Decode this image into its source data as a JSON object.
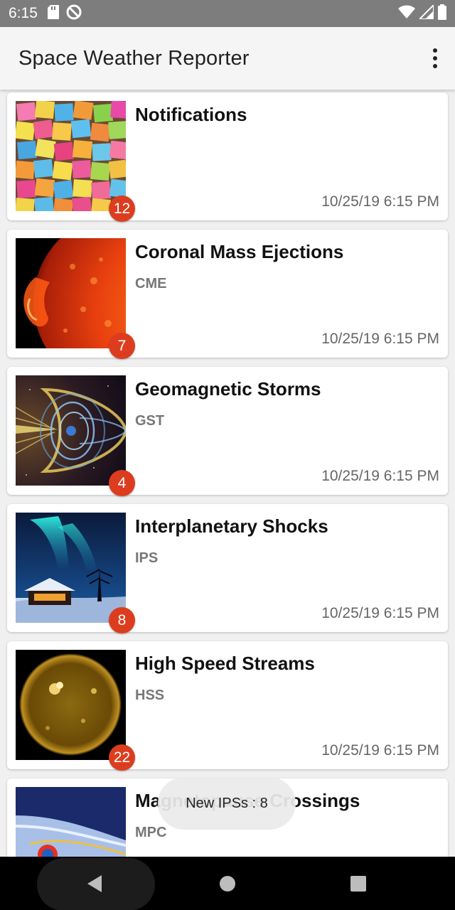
{
  "status_bar": {
    "time": "6:15",
    "icons": [
      "sd-card-icon",
      "no-disturb-icon",
      "wifi-icon",
      "signal-icon",
      "battery-icon"
    ]
  },
  "app_bar": {
    "title": "Space Weather Reporter",
    "overflow_icon": "more-vert-icon"
  },
  "cards": [
    {
      "title": "Notifications",
      "subtitle": "",
      "badge": "12",
      "timestamp": "10/25/19 6:15 PM",
      "image": "sticky-notes-image"
    },
    {
      "title": "Coronal Mass Ejections",
      "subtitle": "CME",
      "badge": "7",
      "timestamp": "10/25/19 6:15 PM",
      "image": "sun-flare-image"
    },
    {
      "title": "Geomagnetic Storms",
      "subtitle": "GST",
      "badge": "4",
      "timestamp": "10/25/19 6:15 PM",
      "image": "magnetosphere-image"
    },
    {
      "title": "Interplanetary Shocks",
      "subtitle": "IPS",
      "badge": "8",
      "timestamp": "10/25/19 6:15 PM",
      "image": "aurora-image"
    },
    {
      "title": "High Speed Streams",
      "subtitle": "HSS",
      "badge": "22",
      "timestamp": "10/25/19 6:15 PM",
      "image": "sun-disk-image"
    },
    {
      "title": "Magnetopause Crossings",
      "subtitle": "MPC",
      "badge": "",
      "timestamp": "",
      "image": "magnetopause-image"
    }
  ],
  "toast": {
    "text": "New IPSs : 8"
  },
  "nav_bar": {
    "buttons": [
      "back-icon",
      "home-icon",
      "recents-icon"
    ]
  },
  "colors": {
    "badge": "#dd3d1f",
    "status_bar": "#7d7d7d",
    "app_bar": "#f5f5f5"
  }
}
